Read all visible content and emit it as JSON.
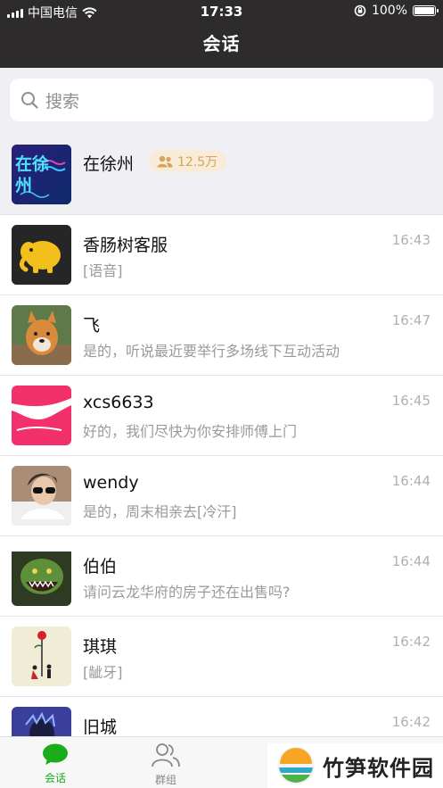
{
  "status_bar": {
    "carrier": "中国电信",
    "time": "17:33",
    "battery": "100%"
  },
  "nav": {
    "title": "会话"
  },
  "search": {
    "placeholder": "搜索"
  },
  "group": {
    "name": "在徐州",
    "avatar_text": "在徐州",
    "member_count": "12.5万"
  },
  "conversations": [
    {
      "name": "香肠树客服",
      "time": "16:43",
      "message": "[语音]"
    },
    {
      "name": "飞",
      "time": "16:47",
      "message": "是的，听说最近要举行多场线下互动活动"
    },
    {
      "name": "xcs6633",
      "time": "16:45",
      "message": "好的，我们尽快为你安排师傅上门"
    },
    {
      "name": "wendy",
      "time": "16:44",
      "message": "是的，周末相亲去[冷汗]"
    },
    {
      "name": "伯伯",
      "time": "16:44",
      "message": "请问云龙华府的房子还在出售吗?"
    },
    {
      "name": "琪琪",
      "time": "16:42",
      "message": "[龇牙]"
    },
    {
      "name": "旧城",
      "time": "16:42",
      "message": ""
    }
  ],
  "tabs": [
    {
      "label": "会话",
      "icon": "chat-bubble-icon",
      "active": true
    },
    {
      "label": "群组",
      "icon": "people-icon",
      "active": false
    }
  ],
  "watermark": {
    "text": "竹笋软件园"
  },
  "colors": {
    "header_bg": "#2e2b2c",
    "accent_green": "#1aad19",
    "badge_text": "#d7a25b"
  }
}
